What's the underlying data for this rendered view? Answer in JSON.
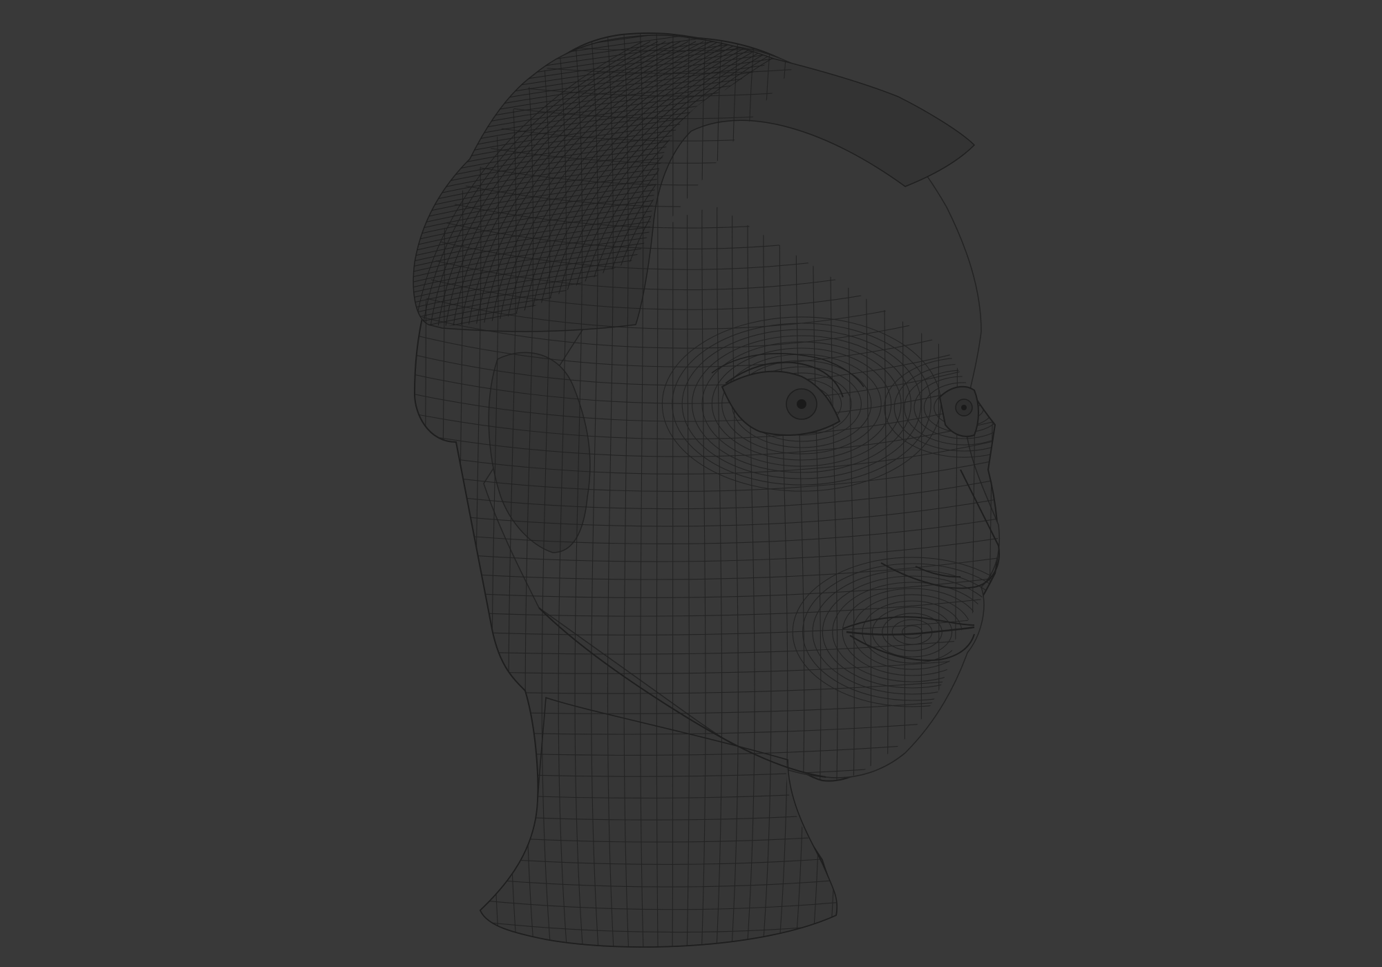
{
  "viewport": {
    "background_color": "#393939",
    "wire_color": "#202020",
    "shade_color": "#2a2a2a",
    "object": "wireframe-head-mesh"
  }
}
